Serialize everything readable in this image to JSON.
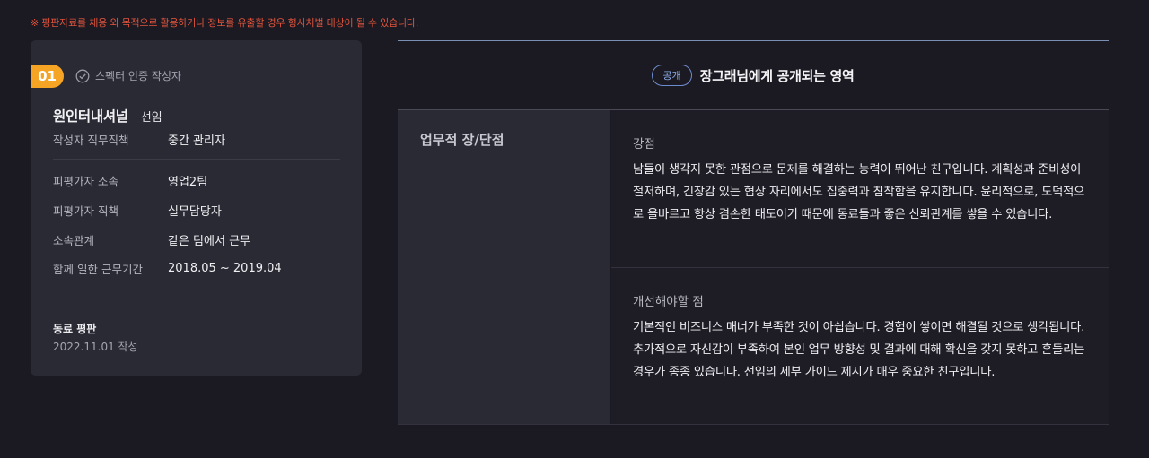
{
  "notice": "※ 평판자료를 채용 외 목적으로 활용하거나 정보를 유출할 경우 형사처벌 대상이 될 수 있습니다.",
  "profile": {
    "number": "01",
    "certified_label": "스펙터 인증 작성자",
    "name": "원인터내셔널",
    "relation": "선임",
    "author_position_label": "작성자 직무직책",
    "author_position_value": "중간 관리자",
    "rows": [
      {
        "label": "피평가자 소속",
        "value": "영업2팀"
      },
      {
        "label": "피평가자 직책",
        "value": "실무담당자"
      },
      {
        "label": "소속관계",
        "value": "같은 팀에서 근무"
      },
      {
        "label": "함께 일한 근무기간",
        "value": "2018.05 ~ 2019.04"
      }
    ],
    "reputation_title": "동료 평판",
    "reputation_date": "2022.11.01 작성"
  },
  "panel": {
    "public_badge": "공개",
    "title": "장그래님에게 공개되는 영역",
    "category": "업무적 장/단점",
    "strength_title": "강점",
    "strength_body": "남들이 생각지 못한 관점으로 문제를 해결하는 능력이 뛰어난 친구입니다. 계획성과 준비성이 철저하며, 긴장감 있는 협상 자리에서도 집중력과 침착함을 유지합니다. 윤리적으로, 도덕적으로 올바르고 항상 겸손한 태도이기 때문에 동료들과 좋은 신뢰관계를 쌓을 수 있습니다.",
    "improve_title": "개선해야할 점",
    "improve_body": "기본적인 비즈니스 매너가 부족한 것이 아쉽습니다. 경험이 쌓이면 해결될 것으로 생각됩니다. 추가적으로 자신감이 부족하여 본인 업무 방향성 및 결과에 대해 확신을 갖지 못하고 흔들리는 경우가 종종 있습니다. 선임의 세부 가이드 제시가 매우 중요한 친구입니다."
  },
  "colors": {
    "accent": "#f5a423",
    "notice": "#e2543c",
    "public_badge": "#6d8ccf"
  }
}
